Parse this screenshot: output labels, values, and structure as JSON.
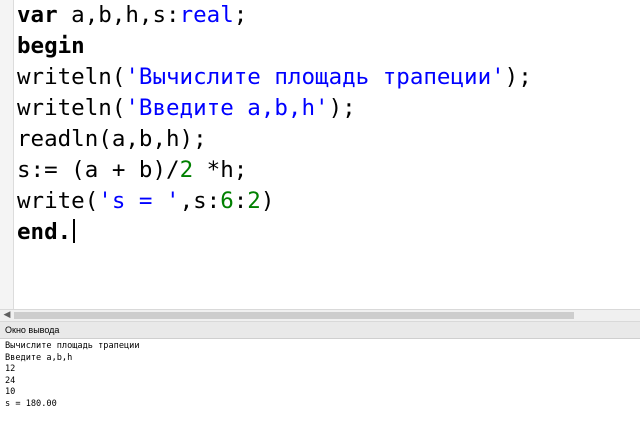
{
  "editor": {
    "lines": [
      [
        {
          "t": "var",
          "c": "kw"
        },
        {
          "t": " a,b,h,s:",
          "c": ""
        },
        {
          "t": "real",
          "c": "ty"
        },
        {
          "t": ";",
          "c": ""
        }
      ],
      [
        {
          "t": "begin",
          "c": "kw"
        }
      ],
      [
        {
          "t": "writeln(",
          "c": ""
        },
        {
          "t": "'Вычислите площадь трапеции'",
          "c": "str"
        },
        {
          "t": ");",
          "c": ""
        }
      ],
      [
        {
          "t": "writeln(",
          "c": ""
        },
        {
          "t": "'Введите a,b,h'",
          "c": "str"
        },
        {
          "t": ");",
          "c": ""
        }
      ],
      [
        {
          "t": "readln(a,b,h);",
          "c": ""
        }
      ],
      [
        {
          "t": "s:= (a + b)/",
          "c": ""
        },
        {
          "t": "2",
          "c": "num"
        },
        {
          "t": " *h;",
          "c": ""
        }
      ],
      [
        {
          "t": "write(",
          "c": ""
        },
        {
          "t": "'s = '",
          "c": "str"
        },
        {
          "t": ",s:",
          "c": ""
        },
        {
          "t": "6",
          "c": "num"
        },
        {
          "t": ":",
          "c": ""
        },
        {
          "t": "2",
          "c": "num"
        },
        {
          "t": ")",
          "c": ""
        }
      ],
      [
        {
          "t": "end.",
          "c": "kw"
        }
      ]
    ]
  },
  "output_panel": {
    "title": "Окно вывода",
    "lines": [
      "Вычислите площадь трапеции",
      "Введите a,b,h",
      "12",
      "24",
      "10",
      "s = 180.00"
    ]
  },
  "icons": {
    "scroll_left": "chevron-left-icon"
  }
}
